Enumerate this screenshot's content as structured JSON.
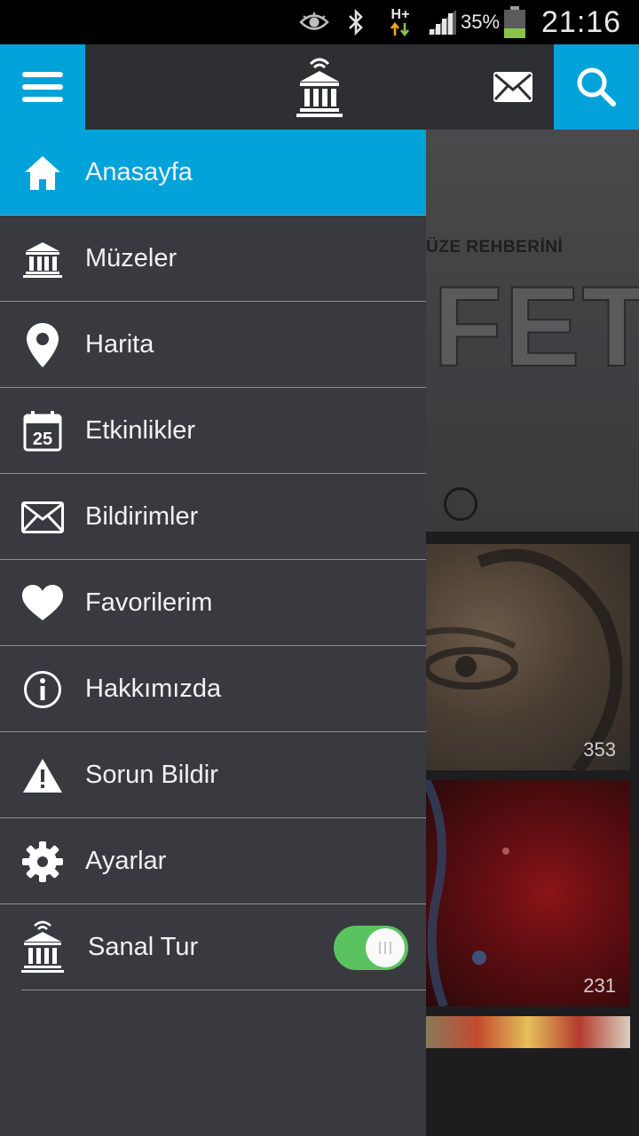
{
  "status_bar": {
    "icons": [
      "eye-icon",
      "bluetooth-icon",
      "hplus-data-icon",
      "signal-icon",
      "battery-icon"
    ],
    "network_label": "H+",
    "battery_percent": "35%",
    "battery_level": 0.35,
    "time": "21:16"
  },
  "app_bar": {
    "menu_icon": "hamburger-menu-icon",
    "logo_icon": "museum-wifi-logo-icon",
    "mail_icon": "envelope-icon",
    "search_icon": "search-icon"
  },
  "colors": {
    "accent": "#00a3d9",
    "drawer_bg": "#393a3f",
    "app_bar_bg": "#2e2f33",
    "toggle_on": "#5ac35f"
  },
  "drawer": {
    "items": [
      {
        "label": "Anasayfa",
        "icon": "home-icon",
        "active": true
      },
      {
        "label": "Müzeler",
        "icon": "museum-icon"
      },
      {
        "label": "Harita",
        "icon": "map-pin-icon"
      },
      {
        "label": "Etkinlikler",
        "icon": "calendar-icon",
        "icon_text": "25"
      },
      {
        "label": "Bildirimler",
        "icon": "envelope-icon"
      },
      {
        "label": "Favorilerim",
        "icon": "heart-icon"
      },
      {
        "label": "Hakkımızda",
        "icon": "info-icon"
      },
      {
        "label": "Sorun Bildir",
        "icon": "warning-icon"
      },
      {
        "label": "Ayarlar",
        "icon": "gear-icon"
      }
    ],
    "virtual_tour": {
      "label": "Sanal Tur",
      "icon": "museum-wifi-icon",
      "toggle_on": true
    }
  },
  "background": {
    "banner_text": "ÜZE REHBERİNİ",
    "banner_big_text": "FET",
    "tiles": [
      {
        "count": "353"
      },
      {
        "count": "231"
      }
    ]
  }
}
